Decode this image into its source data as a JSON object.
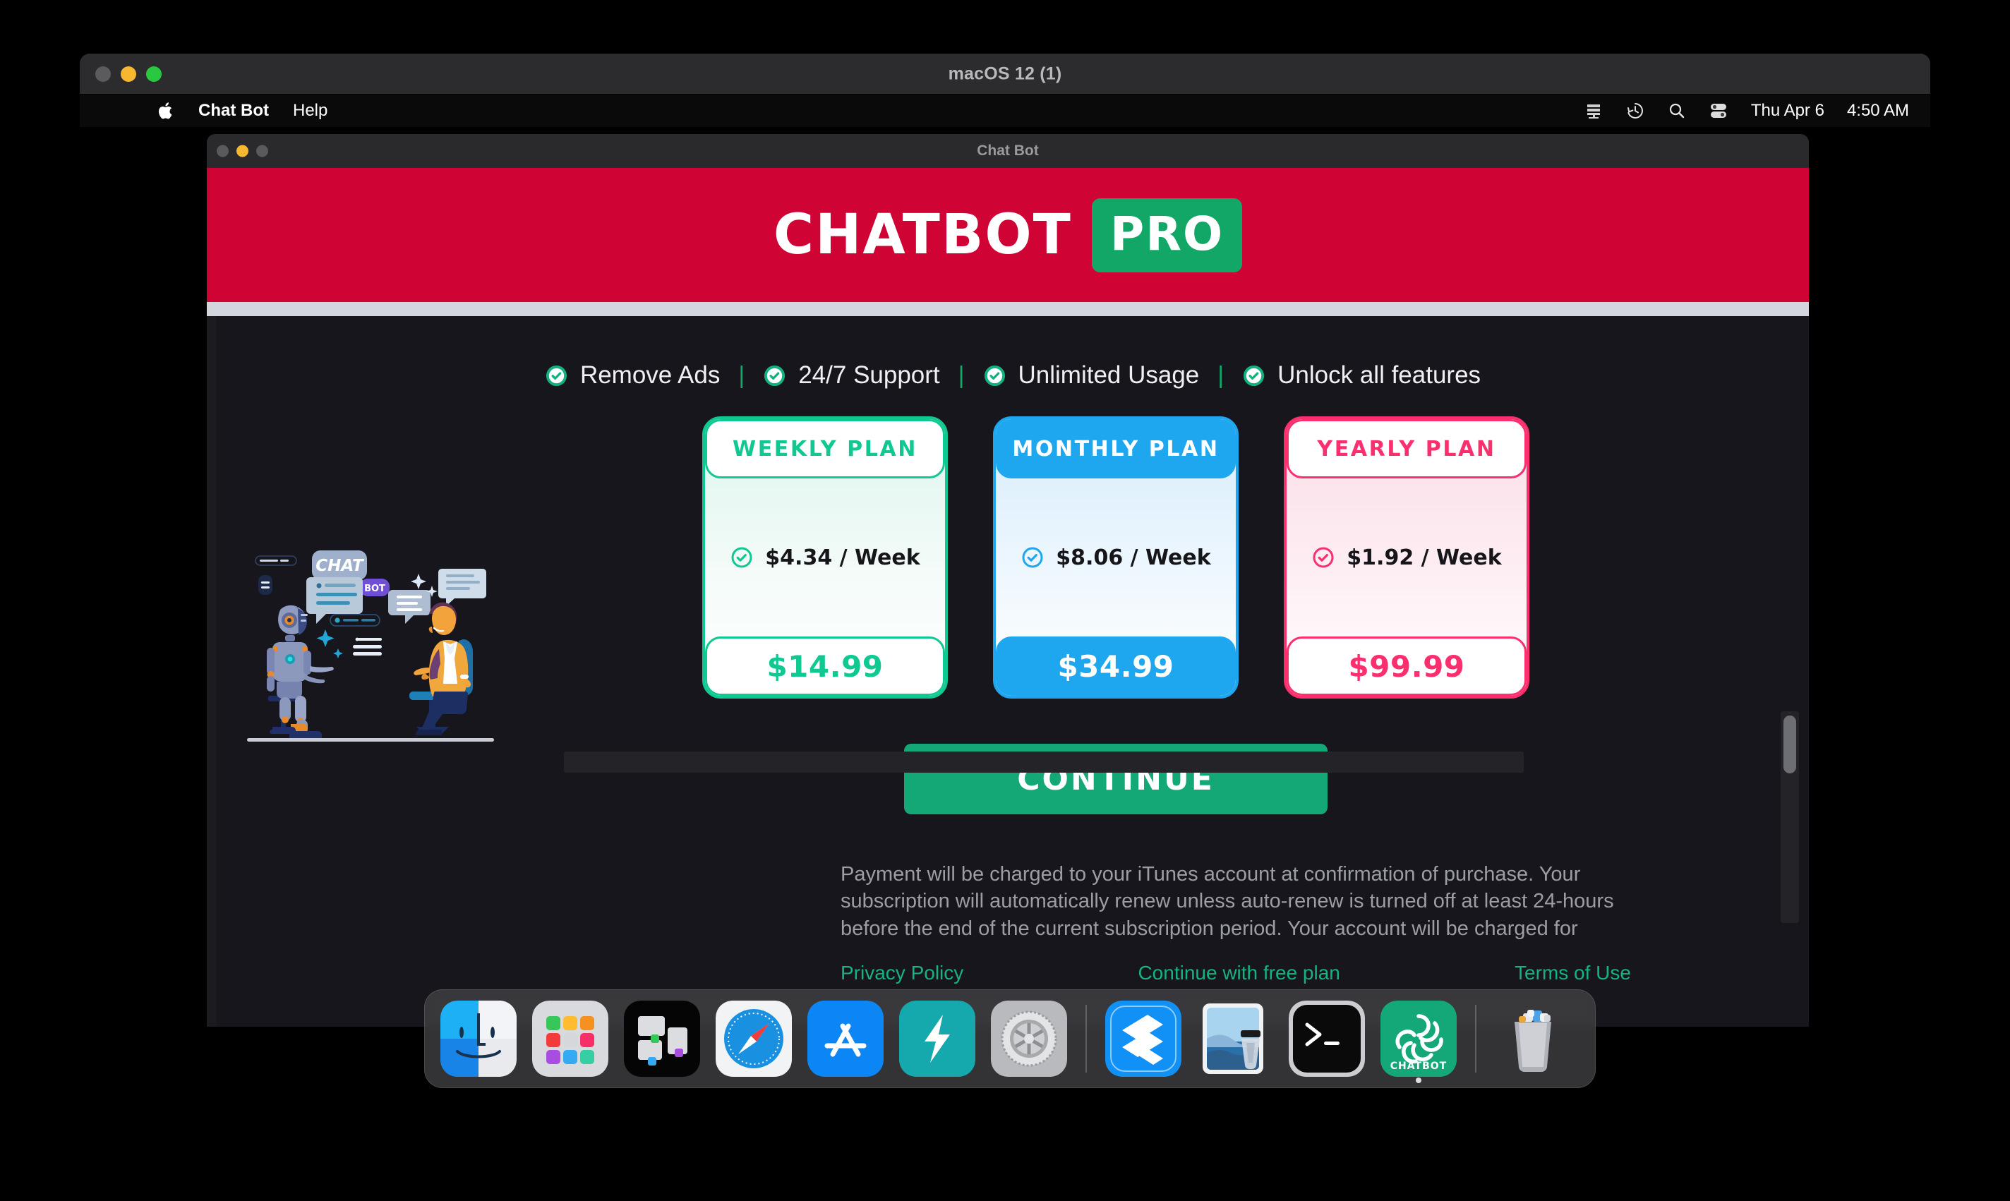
{
  "outer_window": {
    "title": "macOS 12 (1)",
    "traffic_lights": [
      "close",
      "minimize",
      "zoom"
    ]
  },
  "menubar": {
    "apple_icon": "apple-logo-icon",
    "items": [
      {
        "label": "Chat Bot",
        "bold": true
      },
      {
        "label": "Help",
        "bold": false
      }
    ],
    "status_icons": [
      "display-icon",
      "time-machine-icon",
      "spotlight-search-icon",
      "control-center-icon"
    ],
    "date": "Thu Apr 6",
    "time": "4:50 AM"
  },
  "app_window": {
    "title": "Chat Bot",
    "header": {
      "brand": "CHATBOT",
      "badge": "PRO",
      "brand_bg": "#cf0435",
      "badge_bg": "#12a766"
    },
    "features": [
      {
        "label": "Remove Ads",
        "icon": "check-circle-icon"
      },
      {
        "label": "24/7 Support",
        "icon": "check-circle-icon"
      },
      {
        "label": "Unlimited Usage",
        "icon": "check-circle-icon"
      },
      {
        "label": "Unlock all features",
        "icon": "check-circle-icon"
      }
    ],
    "feature_separator": "|",
    "plans": [
      {
        "id": "weekly",
        "title": "WEEKLY PLAN",
        "rate": "$4.34 / Week",
        "total": "$14.99",
        "accent": "#10c891",
        "selected": false
      },
      {
        "id": "monthly",
        "title": "MONTHLY PLAN",
        "rate": "$8.06 / Week",
        "total": "$34.99",
        "accent": "#1ea7ef",
        "selected": true
      },
      {
        "id": "yearly",
        "title": "YEARLY PLAN",
        "rate": "$1.92 / Week",
        "total": "$99.99",
        "accent": "#fb2e6e",
        "selected": false
      }
    ],
    "continue_label": "CONTINUE",
    "continue_color": "#15a877",
    "disclaimer": "Payment will be charged to your iTunes account at confirmation of purchase. Your subscription will automatically renew unless auto-renew is turned off at least 24-hours before the end of the current subscription period. Your account will be charged for",
    "legal_links": [
      {
        "label": "Privacy Policy"
      },
      {
        "label": "Continue with free plan"
      },
      {
        "label": "Terms of Use"
      }
    ],
    "illustration": {
      "chat_label": "CHAT",
      "bot_label": "BOT"
    }
  },
  "dock": {
    "items": [
      {
        "name": "finder",
        "label": "Finder",
        "running": false
      },
      {
        "name": "launchpad",
        "label": "Launchpad",
        "running": false
      },
      {
        "name": "mission-control",
        "label": "Mission Control",
        "running": false
      },
      {
        "name": "safari",
        "label": "Safari",
        "running": false
      },
      {
        "name": "app-store",
        "label": "App Store",
        "running": false
      },
      {
        "name": "shortcuts",
        "label": "Shortcuts",
        "running": false
      },
      {
        "name": "system-preferences",
        "label": "System Preferences",
        "running": false
      },
      {
        "name": "separator",
        "label": "",
        "running": false
      },
      {
        "name": "editor",
        "label": "Editor",
        "running": false
      },
      {
        "name": "preview",
        "label": "Preview",
        "running": false
      },
      {
        "name": "terminal",
        "label": "Terminal",
        "running": false
      },
      {
        "name": "chatbot",
        "label": "CHATBOT",
        "running": true
      },
      {
        "name": "separator",
        "label": "",
        "running": false
      },
      {
        "name": "trash",
        "label": "Trash",
        "running": false
      }
    ],
    "chatbot_icon_label": "CHATBOT"
  }
}
